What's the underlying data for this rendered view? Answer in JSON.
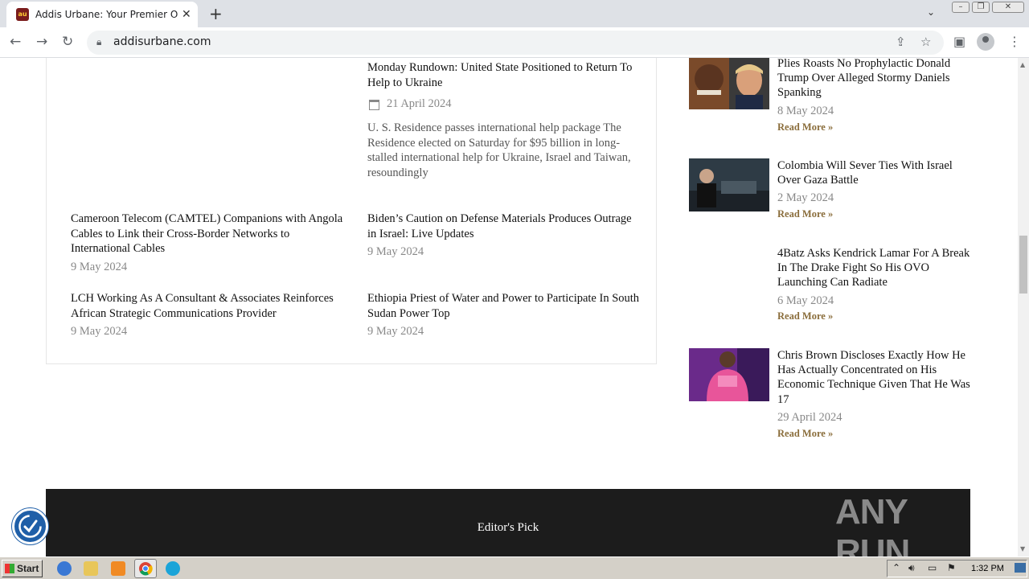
{
  "browser": {
    "tab_title": "Addis Urbane: Your Premier Online N",
    "favicon_text": "au",
    "url": "addisurbane.com"
  },
  "main": {
    "top_post": {
      "title": "Monday Rundown: United State Positioned to Return To Help to Ukraine",
      "date": "21 April 2024",
      "excerpt": "U. S. Residence passes international help package The Residence elected on Saturday for $95 billion in long-stalled international help for Ukraine, Israel and Taiwan, resoundingly"
    },
    "posts": [
      {
        "title": "Cameroon Telecom (CAMTEL) Companions with Angola Cables to Link their Cross-Border Networks to International Cables",
        "date": "9 May 2024"
      },
      {
        "title": "Biden’s Caution on Defense Materials Produces Outrage in Israel: Live Updates",
        "date": "9 May 2024"
      },
      {
        "title": "LCH Working As A Consultant & Associates Reinforces African Strategic Communications Provider",
        "date": "9 May 2024"
      },
      {
        "title": "Ethiopia Priest of Water and Power to Participate In South Sudan Power Top",
        "date": "9 May 2024"
      }
    ]
  },
  "sidebar": {
    "read_more": "Read More »",
    "items": [
      {
        "title": "Plies Roasts No Prophylactic Donald Trump Over Alleged Stormy Daniels Spanking",
        "date": "8 May 2024"
      },
      {
        "title": "Colombia Will Sever Ties With Israel Over Gaza Battle",
        "date": "2 May 2024"
      },
      {
        "title": "4Batz Asks Kendrick Lamar For A Break In The Drake Fight So His OVO Launching Can Radiate",
        "date": "6 May 2024"
      },
      {
        "title": "Chris Brown Discloses Exactly How He Has Actually Concentrated on His Economic Technique Given That He Was 17",
        "date": "29 April 2024"
      }
    ]
  },
  "footer": {
    "editors_pick": "Editor's Pick",
    "watermark": "ANY RUN"
  },
  "taskbar": {
    "start_label": "Start",
    "clock": "1:32 PM"
  },
  "colors": {
    "accent_read_more": "#8a6d3b",
    "footer_bg": "#1c1c1c"
  }
}
